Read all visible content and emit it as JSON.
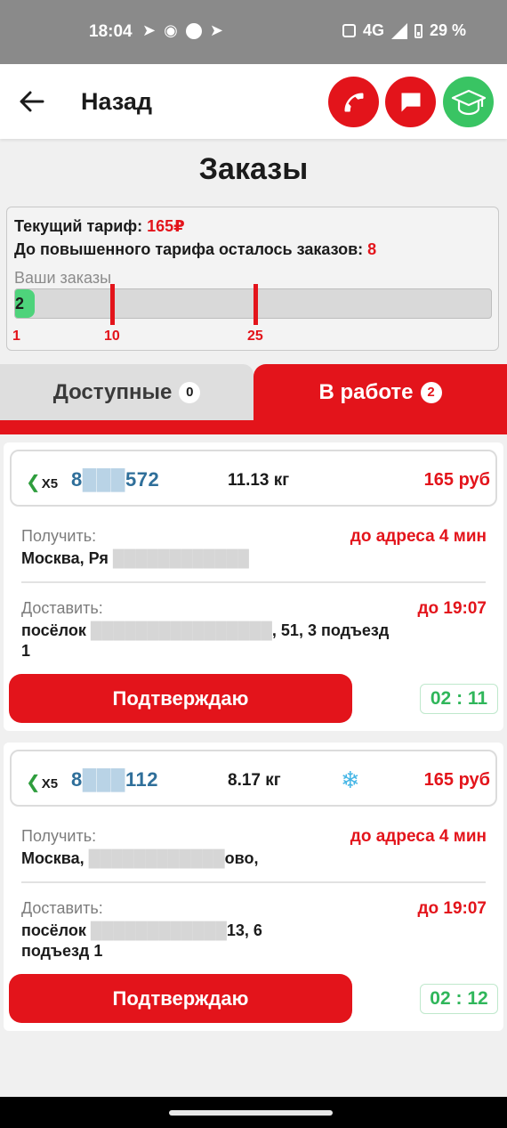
{
  "status_bar": {
    "time": "18:04",
    "network": "4G",
    "battery": "29 %"
  },
  "header": {
    "back_label": "Назад"
  },
  "page_title": "Заказы",
  "tariff": {
    "current_label": "Текущий тариф:",
    "current_value": "165₽",
    "remaining_label": "До повышенного тарифа осталось заказов:",
    "remaining_value": "8",
    "your_orders_label": "Ваши заказы",
    "orders_count": "2",
    "progress_orders": 2,
    "ticks": [
      "1",
      "10",
      "25"
    ]
  },
  "tabs": {
    "available": {
      "label": "Доступные",
      "count": "0"
    },
    "in_work": {
      "label": "В работе",
      "count": "2"
    }
  },
  "orders": [
    {
      "brand": "X5",
      "number_visible_start": "8",
      "number_visible_end": "572",
      "weight": "11.13 кг",
      "price": "165 руб",
      "frozen": false,
      "pickup_label": "Получить:",
      "pickup_eta": "до адреса 4 мин",
      "pickup_address_visible": "Москва, Ря",
      "deliver_label": "Доставить:",
      "deliver_time": "до 19:07",
      "deliver_address_start": "посёлок",
      "deliver_address_end": ", 51, 3 подъезд",
      "deliver_address_line2": "1",
      "confirm_label": "Подтверждаю",
      "timer": "02 : 11"
    },
    {
      "brand": "X5",
      "number_visible_start": "8",
      "number_visible_end": "112",
      "weight": "8.17 кг",
      "price": "165 руб",
      "frozen": true,
      "pickup_label": "Получить:",
      "pickup_eta": "до адреса 4 мин",
      "pickup_address_visible": "Москва,",
      "pickup_address_end": "ово,",
      "deliver_label": "Доставить:",
      "deliver_time": "до 19:07",
      "deliver_address_start": "посёлок",
      "deliver_address_end": "13, 6",
      "deliver_address_line2": "подъезд 1",
      "confirm_label": "Подтверждаю",
      "timer": "02 : 12"
    }
  ],
  "colors": {
    "accent_red": "#e3141b",
    "accent_green": "#39c463",
    "number_blue": "#2f6f9a"
  }
}
